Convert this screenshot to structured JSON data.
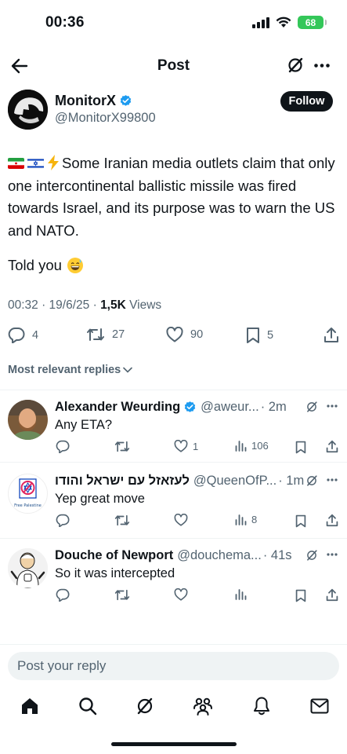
{
  "status_bar": {
    "time": "00:36",
    "battery": "68"
  },
  "header": {
    "title": "Post"
  },
  "post": {
    "author_name": "MonitorX",
    "author_handle": "@MonitorX99800",
    "follow_label": "Follow",
    "text": "Some Iranian media outlets claim that only one intercontinental ballistic missile was fired towards Israel, and its purpose was to warn the US and NATO.",
    "text2": "Told you",
    "timestamp": "00:32 · 19/6/25 · ",
    "views_count": "1,5K",
    "views_label": " Views",
    "replies": "4",
    "reposts": "27",
    "likes": "90",
    "bookmarks": "5"
  },
  "replies_filter": "Most relevant replies",
  "replies": [
    {
      "name": "Alexander Weurding",
      "handle": "@aweur...",
      "time": "· 2m",
      "text": "Any ETA?",
      "replies": "",
      "reposts": "",
      "likes": "1",
      "views": "106"
    },
    {
      "name": "לעזאזל עם ישראל והודו",
      "handle": "@QueenOfP...",
      "time": "· 1m",
      "text": "Yep great move",
      "avatar_caption": "Free Palestine",
      "replies": "",
      "reposts": "",
      "likes": "",
      "views": "8"
    },
    {
      "name": "Douche of Newport",
      "handle": "@douchema...",
      "time": "· 41s",
      "text": "So it was intercepted",
      "replies": "",
      "reposts": "",
      "likes": "",
      "views": ""
    }
  ],
  "composer": {
    "placeholder": "Post your reply"
  },
  "colors": {
    "text": "#0f1419",
    "secondary": "#536471",
    "verified": "#1d9bf0",
    "battery": "#34c759"
  }
}
